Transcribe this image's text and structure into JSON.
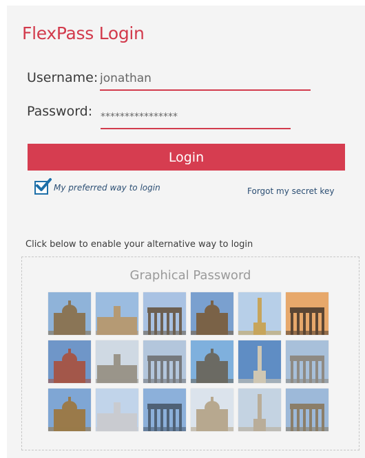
{
  "header": {
    "title": "FlexPass Login"
  },
  "form": {
    "username_label": "Username:",
    "username_value": "jonathan",
    "password_label": "Password:",
    "password_value": "****************",
    "login_button": "Login",
    "preferred_label": "My preferred way to login",
    "preferred_checked": true,
    "forgot_link": "Forgot my secret key"
  },
  "alternative": {
    "caption": "Click below to enable your alternative way to login",
    "graphical_title": "Graphical Password",
    "images": [
      {
        "name": "berlin-cathedral",
        "sky": "#8fb3d9",
        "stone": "#8a7556"
      },
      {
        "name": "charlottenburg-palace",
        "sky": "#9bbce0",
        "stone": "#b59a74"
      },
      {
        "name": "brandenburg-gate",
        "sky": "#a9c2e3",
        "stone": "#6d6052"
      },
      {
        "name": "berlin-cathedral-dome",
        "sky": "#7aa0cf",
        "stone": "#7a6247"
      },
      {
        "name": "victory-column",
        "sky": "#b7cfe8",
        "stone": "#c7a55b"
      },
      {
        "name": "brandenburg-gate-dusk",
        "sky": "#e7a86b",
        "stone": "#5b4634"
      },
      {
        "name": "red-town-hall",
        "sky": "#6f96c8",
        "stone": "#a3574a"
      },
      {
        "name": "statue-square",
        "sky": "#cfd9e3",
        "stone": "#9a958a"
      },
      {
        "name": "holocaust-memorial",
        "sky": "#b3c6dc",
        "stone": "#76797d"
      },
      {
        "name": "tower-bridge",
        "sky": "#7fb0dd",
        "stone": "#6b6a63"
      },
      {
        "name": "st-pauls-cathedral",
        "sky": "#5f8dc4",
        "stone": "#cfc7b3"
      },
      {
        "name": "nelsons-column",
        "sky": "#a8c0da",
        "stone": "#8e8a83"
      },
      {
        "name": "big-ben",
        "sky": "#7fa6d4",
        "stone": "#9a7a4a"
      },
      {
        "name": "london-eye",
        "sky": "#c1d4ea",
        "stone": "#c9cbd0"
      },
      {
        "name": "tower-bridge-blue",
        "sky": "#8cb0da",
        "stone": "#4f6176"
      },
      {
        "name": "buckingham-palace",
        "sky": "#dbe3ec",
        "stone": "#b7a88f"
      },
      {
        "name": "victoria-memorial",
        "sky": "#c4d3e2",
        "stone": "#b9ad99"
      },
      {
        "name": "tower-of-london",
        "sky": "#9db9d9",
        "stone": "#8b7e69"
      }
    ]
  }
}
